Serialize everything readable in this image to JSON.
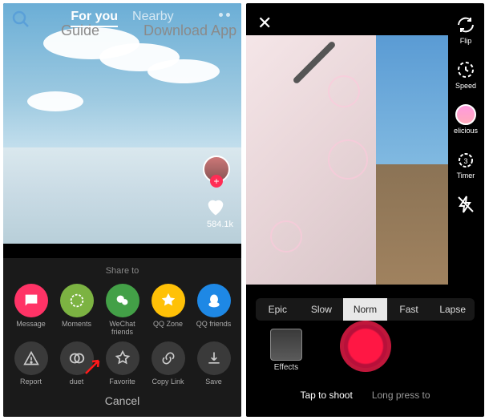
{
  "left": {
    "tabs": {
      "foryou": "For you",
      "nearby": "Nearby"
    },
    "ghost": {
      "guide": "Guide",
      "download": "Download App"
    },
    "likes": "584.1k",
    "sheet": {
      "title": "Share to",
      "row1": [
        {
          "label": "Message",
          "cls": "msg"
        },
        {
          "label": "Moments",
          "cls": "mom"
        },
        {
          "label": "WeChat friends",
          "cls": "wcf"
        },
        {
          "label": "QQ Zone",
          "cls": "qqz"
        },
        {
          "label": "QQ friends",
          "cls": "qqf"
        }
      ],
      "row2": [
        {
          "label": "Report"
        },
        {
          "label": "duet"
        },
        {
          "label": "Favorite"
        },
        {
          "label": "Copy Link"
        },
        {
          "label": "Save"
        }
      ],
      "cancel": "Cancel"
    }
  },
  "right": {
    "tools": {
      "flip": "Flip",
      "speed": "Speed",
      "beauty": "elicious",
      "timer": "Timer"
    },
    "speeds": [
      "Epic",
      "Slow",
      "Norm",
      "Fast",
      "Lapse"
    ],
    "selected_speed": 2,
    "effects": "Effects",
    "modes": {
      "tap": "Tap to shoot",
      "long": "Long press to"
    }
  }
}
